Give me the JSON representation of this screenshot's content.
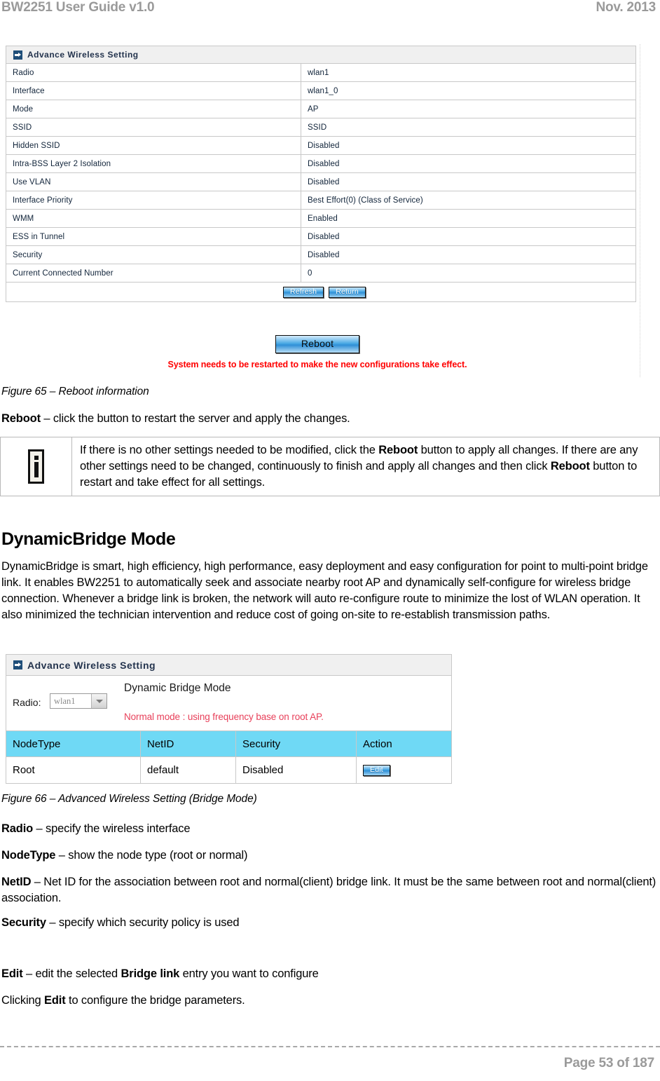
{
  "header": {
    "left": "BW2251 User Guide v1.0",
    "right": "Nov.  2013"
  },
  "figure65": {
    "panel_title": "Advance Wireless Setting",
    "rows": [
      {
        "label": "Radio",
        "value": "wlan1"
      },
      {
        "label": "Interface",
        "value": "wlan1_0"
      },
      {
        "label": "Mode",
        "value": "AP"
      },
      {
        "label": "SSID",
        "value": "SSID"
      },
      {
        "label": "Hidden SSID",
        "value": "Disabled"
      },
      {
        "label": "Intra-BSS Layer 2 Isolation",
        "value": "Disabled"
      },
      {
        "label": "Use VLAN",
        "value": "Disabled"
      },
      {
        "label": "Interface Priority",
        "value": "Best Effort(0)  (Class of Service)"
      },
      {
        "label": "WMM",
        "value": "Enabled"
      },
      {
        "label": "ESS in Tunnel",
        "value": "Disabled"
      },
      {
        "label": "Security",
        "value": " Disabled"
      },
      {
        "label": "Current Connected Number",
        "value": "0"
      }
    ],
    "refresh_label": "Refresh",
    "return_label": "Return",
    "reboot_label": "Reboot",
    "reboot_note": "System needs to be restarted to make the new configurations take effect.",
    "caption": "Figure 65 – Reboot information"
  },
  "reboot_desc": {
    "term": "Reboot",
    "rest": " – click the button to restart the server and apply the changes."
  },
  "notebox": {
    "icon": "info-icon",
    "t1": "If there is no other settings needed to be modified, click the ",
    "b1": "Reboot",
    "t2": " button to apply all changes. If there are any other settings need to be changed, continuously to finish and apply all changes and then click ",
    "b2": "Reboot",
    "t3": " button to restart and take effect  for all settings."
  },
  "section": {
    "heading": "DynamicBridge Mode",
    "intro": "DynamicBridge is smart, high efficiency, high performance, easy deployment and easy configuration for point to multi-point bridge link. It enables BW2251 to automatically seek and associate nearby root AP and dynamically self-configure for wireless bridge connection. Whenever a bridge link is broken, the network will auto re-configure route to minimize the lost of WLAN operation. It also minimized the technician intervention and reduce cost of going on-site to re-establish transmission paths."
  },
  "figure66": {
    "panel_title": "Advance Wireless Setting",
    "radio_label": "Radio:",
    "radio_value": "wlan1",
    "mode_title": "Dynamic Bridge Mode",
    "mode_note": "Normal mode : using frequency base on root AP.",
    "columns": [
      "NodeType",
      "NetID",
      "Security",
      "Action"
    ],
    "row": {
      "nodetype": "Root",
      "netid": "default",
      "security": "Disabled",
      "action": "Edit"
    },
    "caption": "Figure 66 – Advanced Wireless Setting (Bridge Mode)"
  },
  "defs": {
    "radio": {
      "term": "Radio",
      "rest": " – specify the wireless interface"
    },
    "nodetype": {
      "term": "NodeType",
      "rest": " – show the node type (root or normal)"
    },
    "netid": {
      "term": "NetID",
      "rest": " – Net ID for the association between root and normal(client) bridge link. It must be the same between root and normal(client) association."
    },
    "security": {
      "term": "Security",
      "rest": " – specify which security policy is used"
    },
    "edit_t1": "Edit",
    "edit_t2": " – edit the selected ",
    "edit_b2": "Bridge link",
    "edit_t3": " entry you want to configure",
    "click_t1": "Clicking ",
    "click_b1": "Edit",
    "click_t2": " to configure the bridge parameters."
  },
  "footer": {
    "page": "Page 53 of 187"
  },
  "colors": {
    "cyan_header": "#6fd9f5",
    "panel_title_bg": "#f0f0f0",
    "note_red": "#e8405a",
    "warning_red": "#ff0000",
    "header_gray": "#9a9a9a"
  }
}
